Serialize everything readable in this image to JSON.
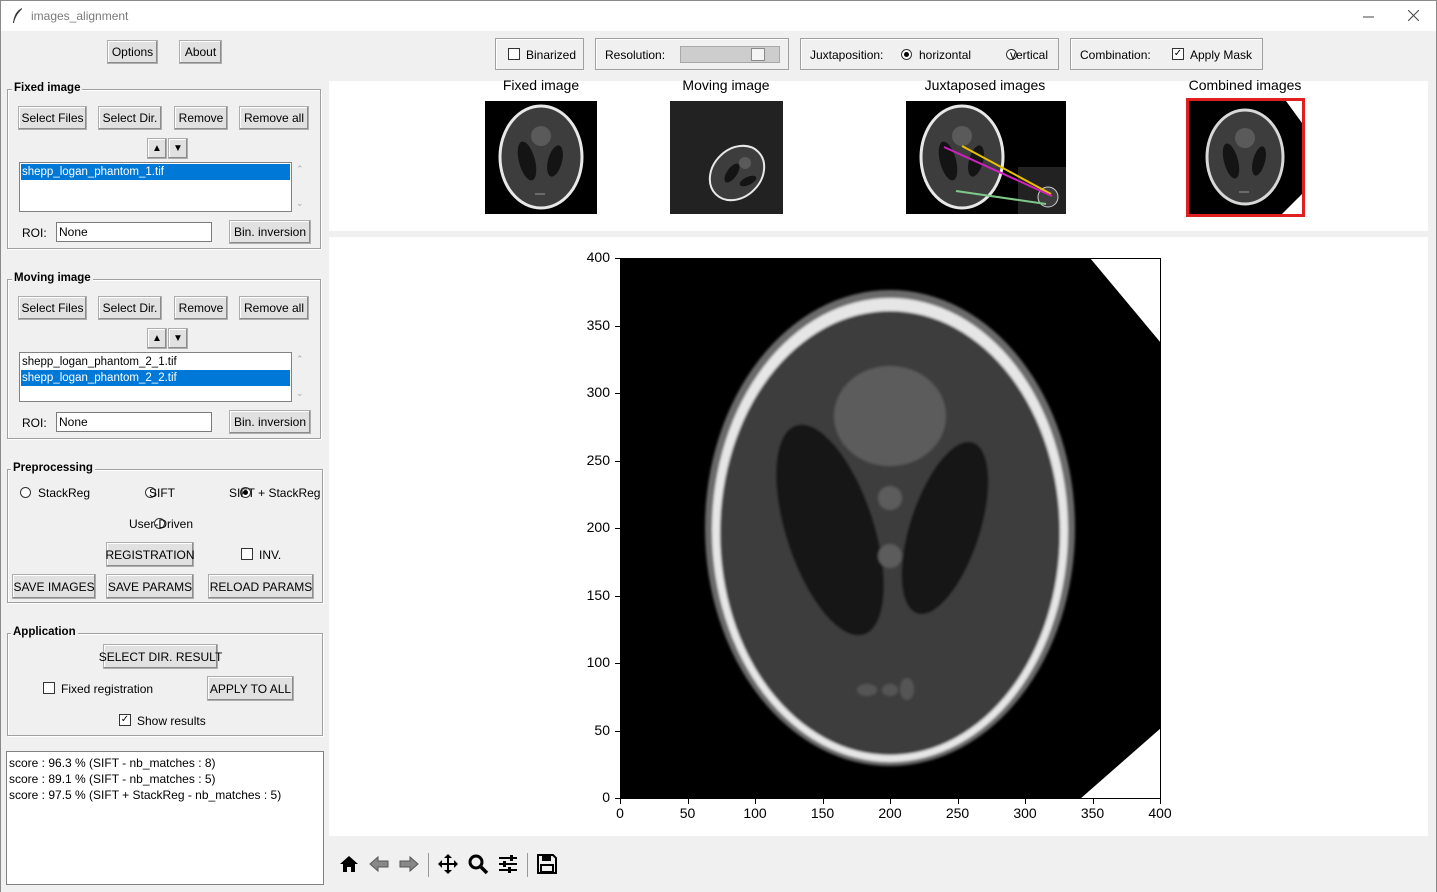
{
  "window": {
    "title": "images_alignment"
  },
  "top_left": {
    "options": "Options",
    "about": "About"
  },
  "toolbar": {
    "binarized": "Binarized",
    "resolution": "Resolution:",
    "resolution_level": 0.85,
    "juxtaposition": "Juxtaposition:",
    "horizontal": "horizontal",
    "vertical": "vertical",
    "combination": "Combination:",
    "apply_mask": "Apply Mask"
  },
  "fixed": {
    "title": "Fixed image",
    "select_files": "Select Files",
    "select_dir": "Select Dir.",
    "remove": "Remove",
    "remove_all": "Remove all",
    "files": [
      "shepp_logan_phantom_1.tif"
    ],
    "roi_label": "ROI:",
    "roi_value": "None",
    "bin_inversion": "Bin. inversion"
  },
  "moving": {
    "title": "Moving image",
    "select_files": "Select Files",
    "select_dir": "Select Dir.",
    "remove": "Remove",
    "remove_all": "Remove all",
    "files": [
      "shepp_logan_phantom_2_1.tif",
      "shepp_logan_phantom_2_2.tif"
    ],
    "roi_label": "ROI:",
    "roi_value": "None",
    "bin_inversion": "Bin. inversion"
  },
  "preprocessing": {
    "title": "Preprocessing",
    "stackreg": "StackReg",
    "sift": "SIFT",
    "sift_stackreg": "SIFT + StackReg",
    "user_driven": "User-Driven",
    "registration": "REGISTRATION",
    "inv": "INV.",
    "save_images": "SAVE IMAGES",
    "save_params": "SAVE PARAMS",
    "reload_params": "RELOAD PARAMS"
  },
  "application": {
    "title": "Application",
    "select_dir_result": "SELECT DIR. RESULT",
    "fixed_registration": "Fixed registration",
    "apply_to_all": "APPLY TO ALL",
    "show_results": "Show results"
  },
  "log": [
    "score : 96.3 % (SIFT - nb_matches : 8)",
    "score : 89.1 % (SIFT - nb_matches : 5)",
    "score : 97.5 % (SIFT + StackReg - nb_matches : 5)"
  ],
  "thumbnails": {
    "fixed": "Fixed image",
    "moving": "Moving image",
    "juxtaposed": "Juxtaposed images",
    "combined": "Combined images"
  },
  "plot": {
    "xticks": [
      "0",
      "50",
      "100",
      "150",
      "200",
      "250",
      "300",
      "350",
      "400"
    ],
    "yticks": [
      "0",
      "50",
      "100",
      "150",
      "200",
      "250",
      "300",
      "350",
      "400"
    ]
  },
  "colors": {
    "selection": "#0078d7",
    "thumb_highlight": "#e02020"
  }
}
